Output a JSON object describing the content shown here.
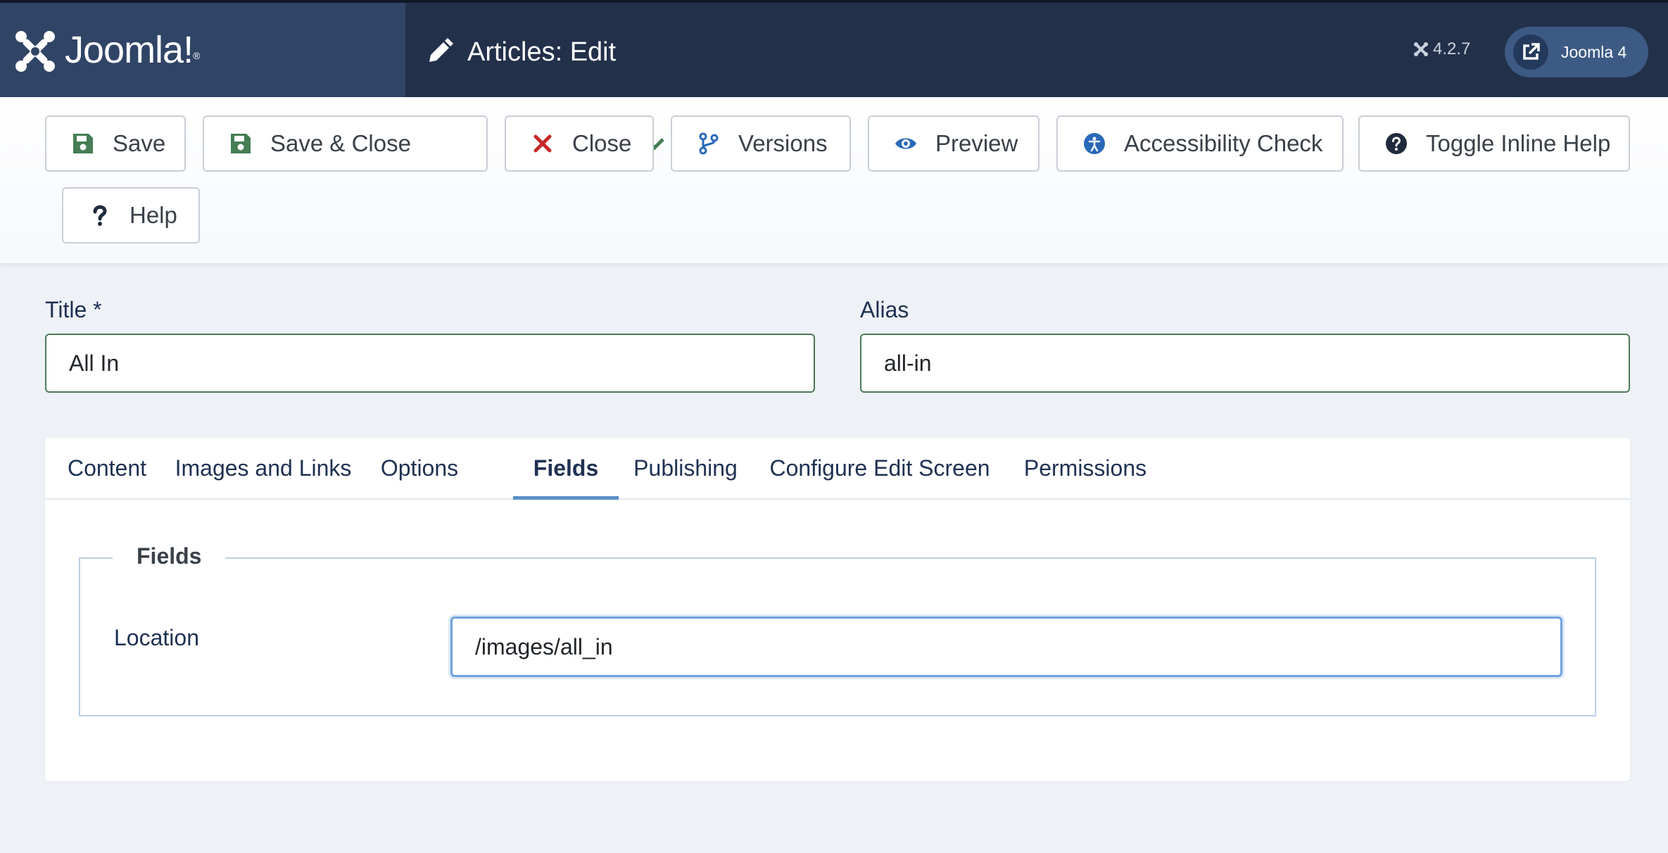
{
  "brand": {
    "name": "Joomla!",
    "mark": "®"
  },
  "header": {
    "title": "Articles: Edit",
    "version": "4.2.7",
    "site_link": "Joomla 4"
  },
  "toolbar": {
    "save": "Save",
    "save_close": "Save & Close",
    "close": "Close",
    "versions": "Versions",
    "preview": "Preview",
    "accessibility": "Accessibility Check",
    "inline_help": "Toggle Inline Help",
    "help": "Help"
  },
  "form": {
    "title_label": "Title *",
    "title_value": "All In",
    "alias_label": "Alias",
    "alias_value": "all-in"
  },
  "tabs": [
    "Content",
    "Images and Links",
    "Options",
    "Fields",
    "Publishing",
    "Configure Edit Screen",
    "Permissions"
  ],
  "active_tab": "Fields",
  "fields_panel": {
    "legend": "Fields",
    "location_label": "Location",
    "location_value": "/images/all_in"
  },
  "colors": {
    "header": "#22304a",
    "logo_bg": "#304466",
    "save_green": "#457d54",
    "close_red": "#c52827",
    "accent_blue": "#2a69b8"
  }
}
